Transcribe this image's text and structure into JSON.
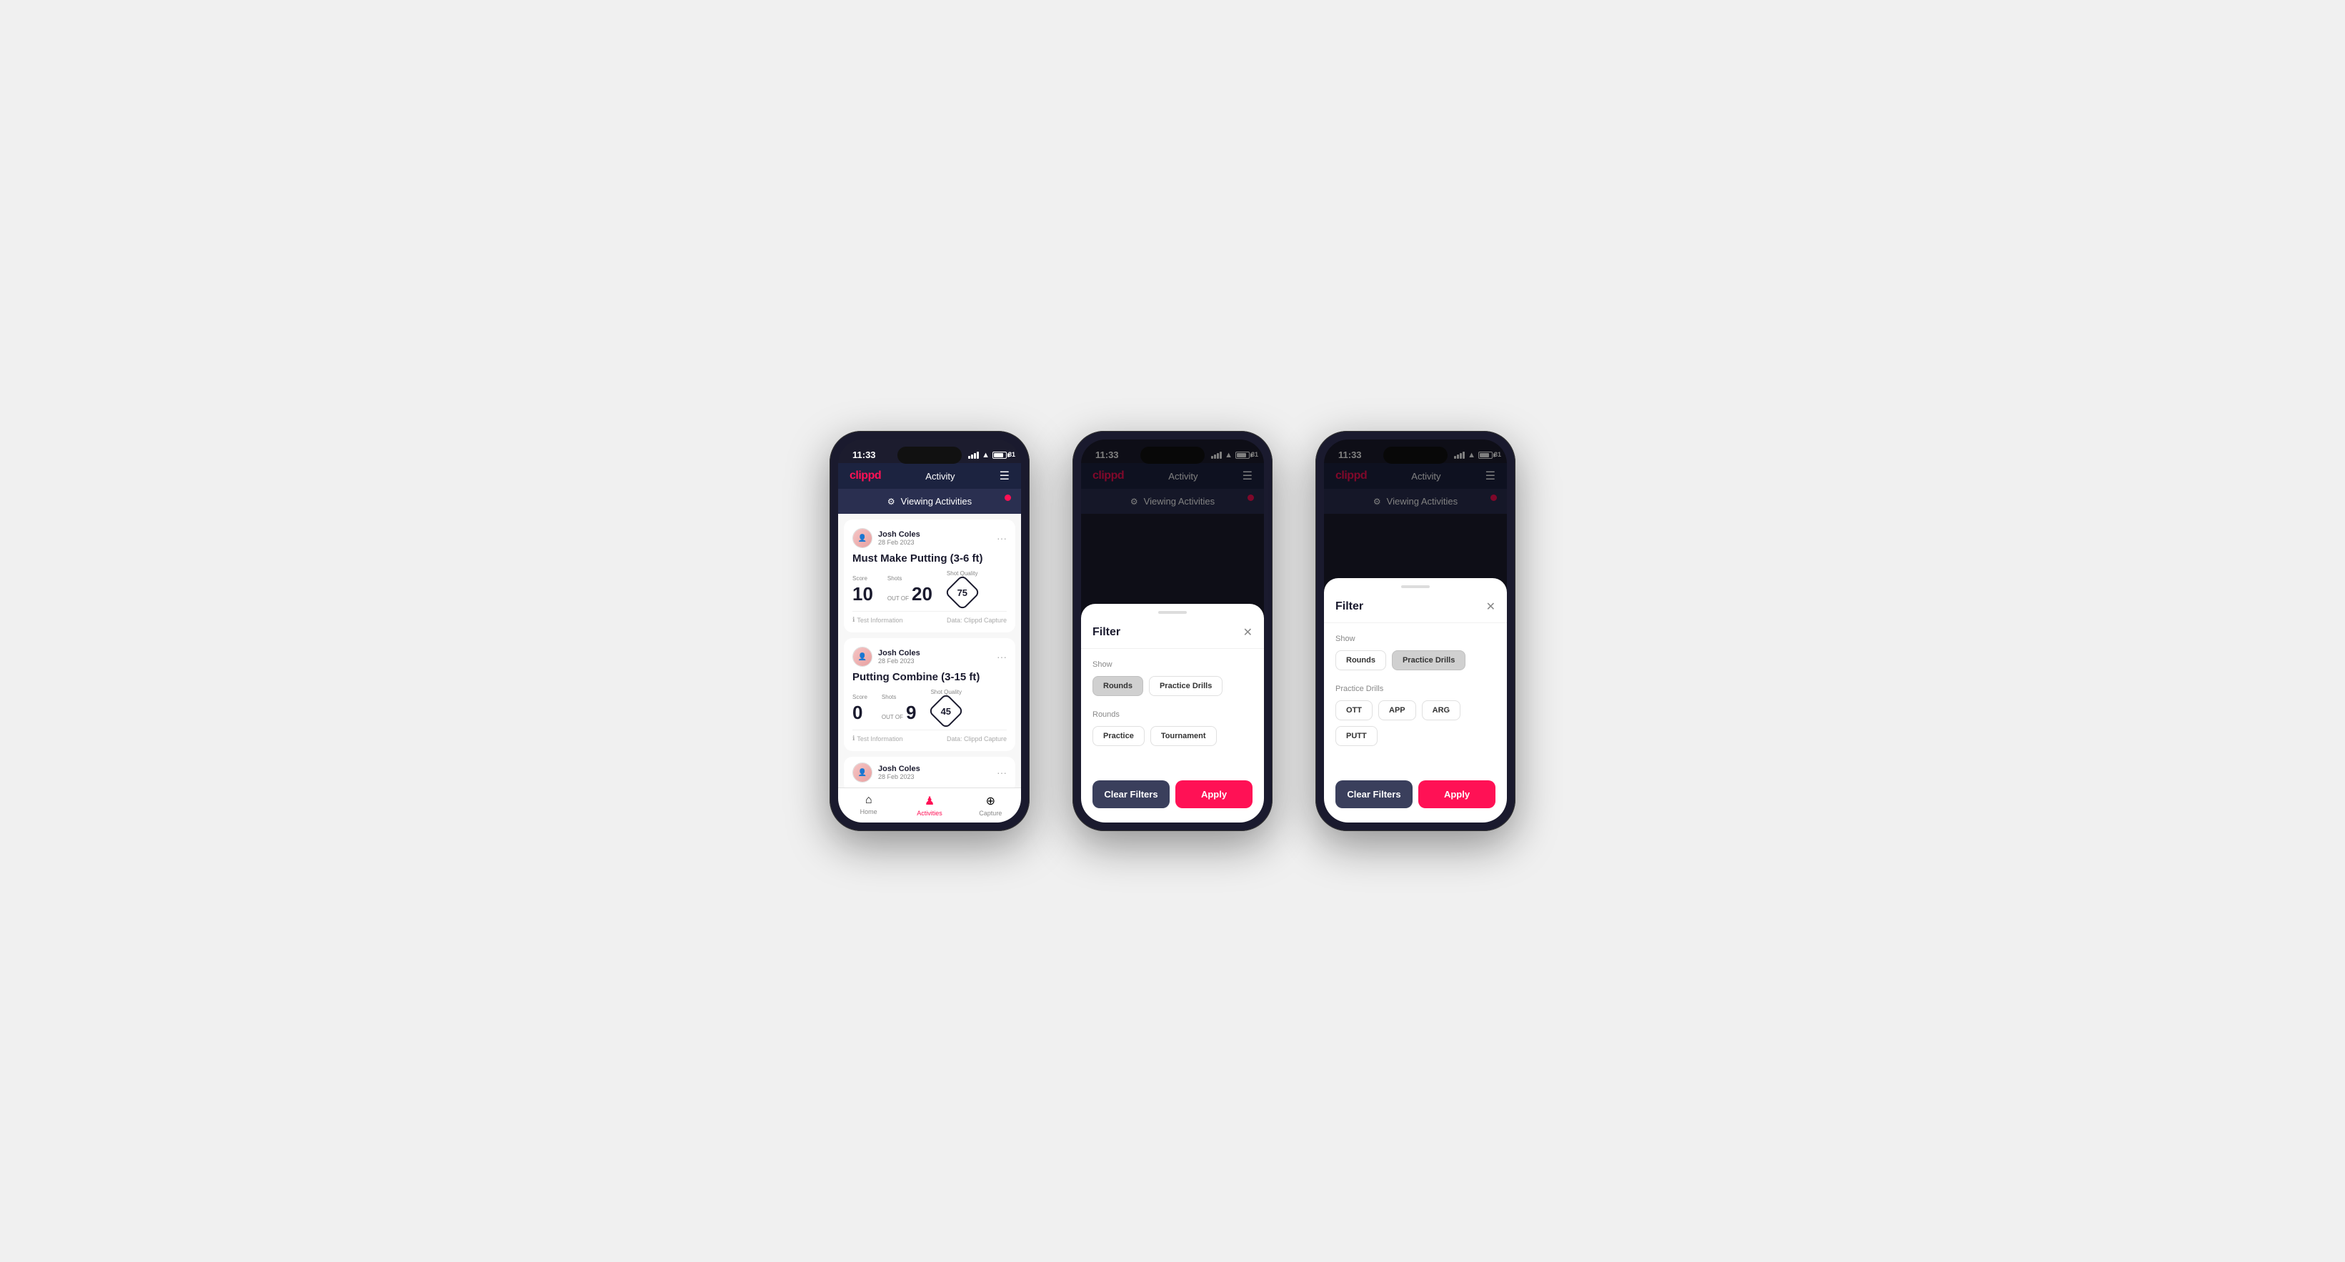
{
  "phones": [
    {
      "id": "phone1",
      "time": "11:33",
      "battery": "31",
      "header": {
        "logo": "clippd",
        "title": "Activity",
        "menu_icon": "☰"
      },
      "viewing_bar": {
        "text": "Viewing Activities",
        "has_dot": true
      },
      "cards": [
        {
          "id": "card1",
          "user_name": "Josh Coles",
          "user_date": "28 Feb 2023",
          "title": "Must Make Putting (3-6 ft)",
          "score_label": "Score",
          "score_value": "10",
          "shots_label": "Shots",
          "shots_value": "20",
          "shot_quality_label": "Shot Quality",
          "shot_quality_value": "75",
          "footer_info": "Test Information",
          "footer_data": "Data: Clippd Capture"
        },
        {
          "id": "card2",
          "user_name": "Josh Coles",
          "user_date": "28 Feb 2023",
          "title": "Putting Combine (3-15 ft)",
          "score_label": "Score",
          "score_value": "0",
          "shots_label": "Shots",
          "shots_value": "9",
          "shot_quality_label": "Shot Quality",
          "shot_quality_value": "45",
          "footer_info": "Test Information",
          "footer_data": "Data: Clippd Capture"
        },
        {
          "id": "card3",
          "user_name": "Josh Coles",
          "user_date": "28 Feb 2023",
          "title": "",
          "partial": true
        }
      ],
      "bottom_nav": [
        {
          "id": "home",
          "icon": "🏠",
          "label": "Home",
          "active": false
        },
        {
          "id": "activities",
          "icon": "👤",
          "label": "Activities",
          "active": true
        },
        {
          "id": "capture",
          "icon": "⊕",
          "label": "Capture",
          "active": false
        }
      ],
      "modal": null
    },
    {
      "id": "phone2",
      "time": "11:33",
      "battery": "31",
      "header": {
        "logo": "clippd",
        "title": "Activity",
        "menu_icon": "☰"
      },
      "viewing_bar": {
        "text": "Viewing Activities",
        "has_dot": true
      },
      "modal": {
        "type": "filter",
        "title": "Filter",
        "show_label": "Show",
        "show_options": [
          {
            "id": "rounds",
            "label": "Rounds",
            "active": true
          },
          {
            "id": "practice-drills",
            "label": "Practice Drills",
            "active": false
          }
        ],
        "rounds_label": "Rounds",
        "rounds_options": [
          {
            "id": "practice",
            "label": "Practice",
            "active": false
          },
          {
            "id": "tournament",
            "label": "Tournament",
            "active": false
          }
        ],
        "practice_drills_options": null,
        "clear_label": "Clear Filters",
        "apply_label": "Apply"
      }
    },
    {
      "id": "phone3",
      "time": "11:33",
      "battery": "31",
      "header": {
        "logo": "clippd",
        "title": "Activity",
        "menu_icon": "☰"
      },
      "viewing_bar": {
        "text": "Viewing Activities",
        "has_dot": true
      },
      "modal": {
        "type": "filter",
        "title": "Filter",
        "show_label": "Show",
        "show_options": [
          {
            "id": "rounds",
            "label": "Rounds",
            "active": false
          },
          {
            "id": "practice-drills",
            "label": "Practice Drills",
            "active": true
          }
        ],
        "rounds_label": null,
        "rounds_options": null,
        "practice_drills_label": "Practice Drills",
        "practice_drills_options": [
          {
            "id": "ott",
            "label": "OTT",
            "active": false
          },
          {
            "id": "app",
            "label": "APP",
            "active": false
          },
          {
            "id": "arg",
            "label": "ARG",
            "active": false
          },
          {
            "id": "putt",
            "label": "PUTT",
            "active": false
          }
        ],
        "clear_label": "Clear Filters",
        "apply_label": "Apply"
      }
    }
  ]
}
